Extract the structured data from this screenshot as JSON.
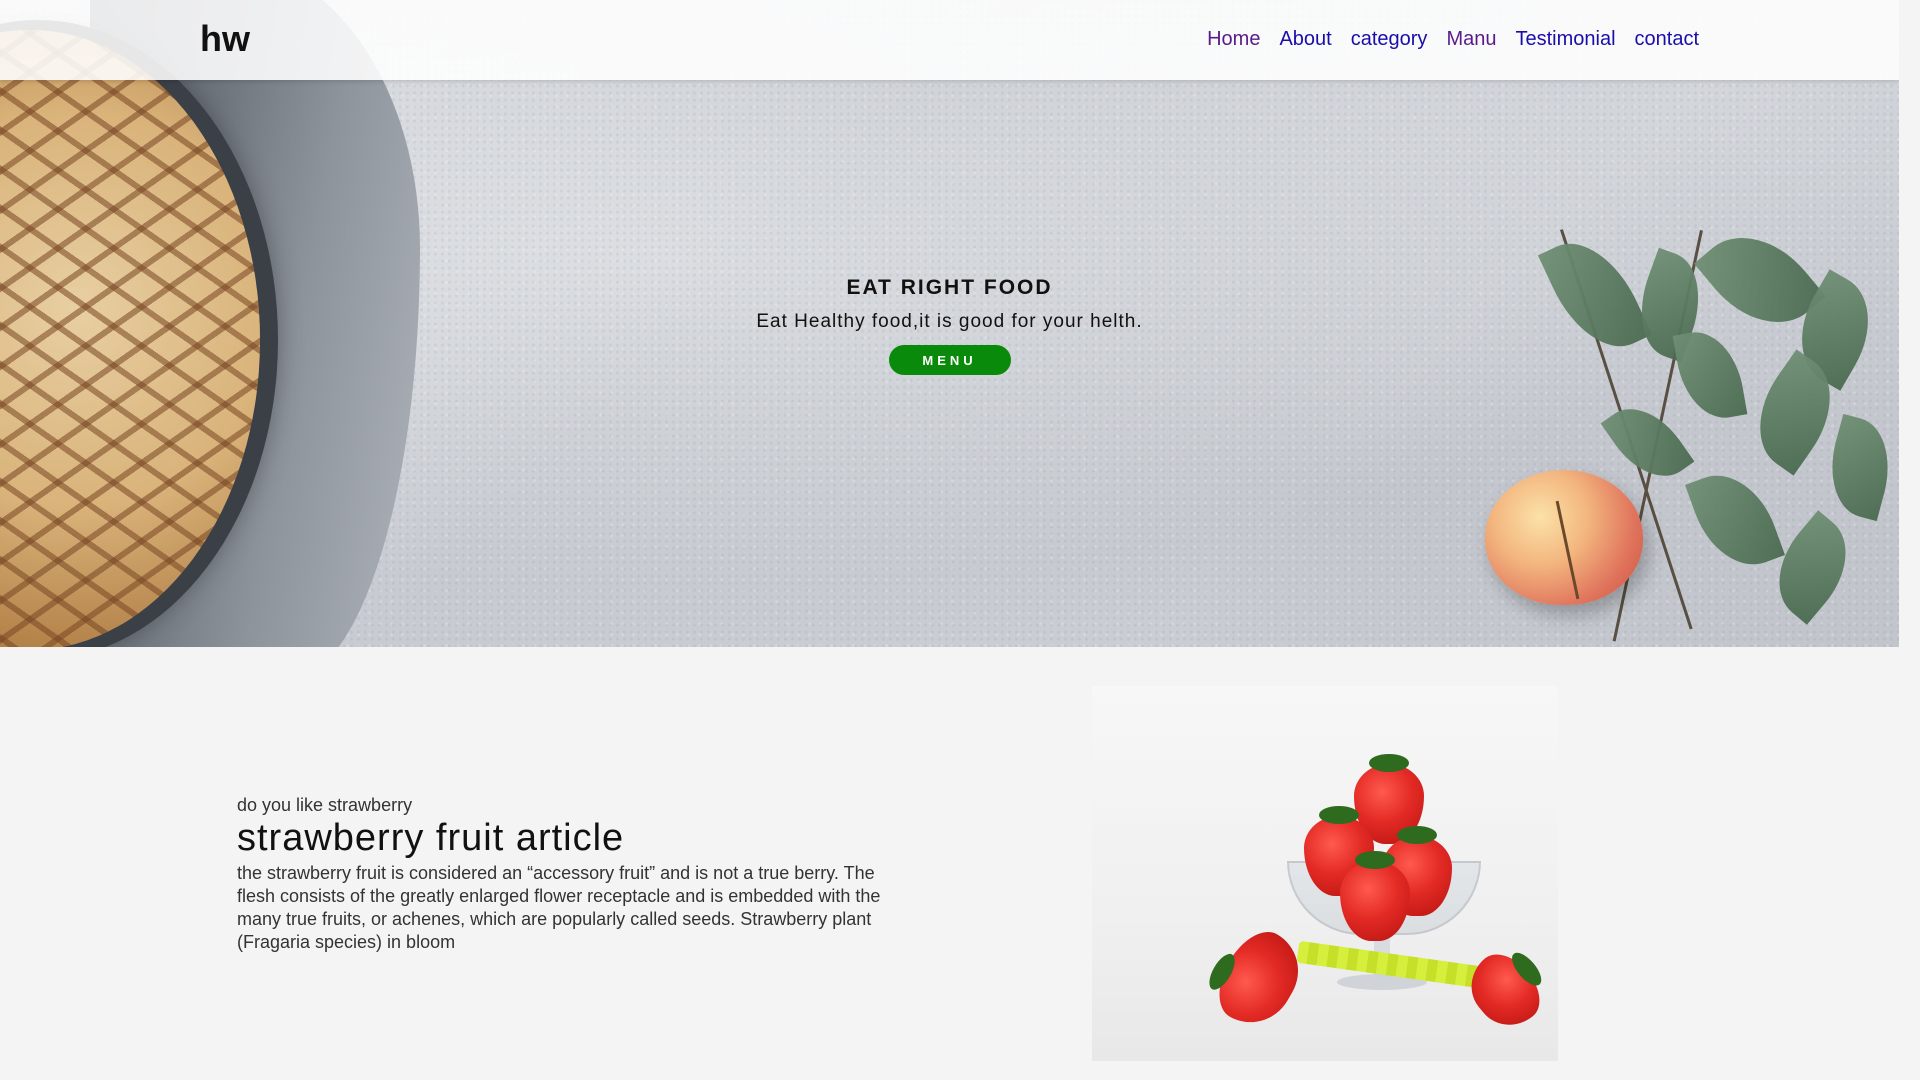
{
  "header": {
    "logo": "hw",
    "nav": [
      {
        "label": "Home"
      },
      {
        "label": "About"
      },
      {
        "label": "category"
      },
      {
        "label": "Manu"
      },
      {
        "label": "Testimonial"
      },
      {
        "label": "contact"
      }
    ]
  },
  "hero": {
    "title": "EAT RIGHT FOOD",
    "subtitle": "Eat Healthy food,it is good for your helth.",
    "button_label": "MENU"
  },
  "article": {
    "kicker": "do you like strawberry",
    "title": "strawberry fruit article",
    "body": "the strawberry fruit is considered an “accessory fruit” and is not a true berry. The flesh consists of the greatly enlarged flower receptacle and is embedded with the many true fruits, or achenes, which are popularly called seeds. Strawberry plant (Fragaria species) in bloom"
  },
  "colors": {
    "menu_button": "#0a8a0a",
    "link": "#1a0dab",
    "visited_link": "#5b1a8a"
  },
  "icons": {
    "scroll_up": "scroll-up-arrow-icon",
    "scroll_down": "scroll-down-arrow-icon"
  }
}
